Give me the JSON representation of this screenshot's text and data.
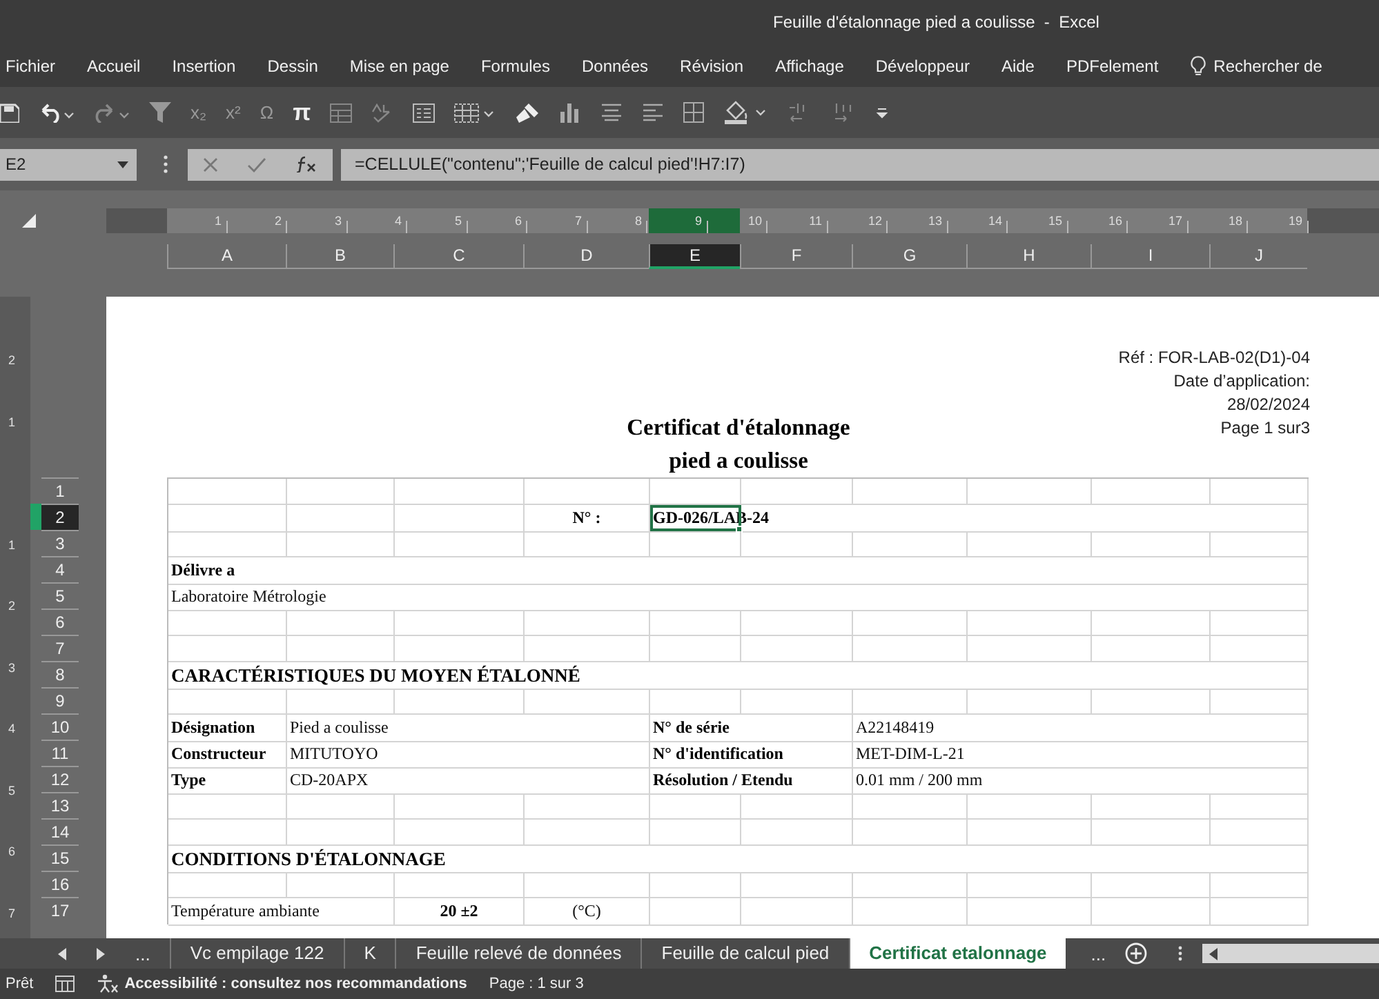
{
  "window": {
    "title": "Feuille d'étalonnage pied a coulisse  -  Excel"
  },
  "menu": [
    "Fichier",
    "Accueil",
    "Insertion",
    "Dessin",
    "Mise en page",
    "Formules",
    "Données",
    "Révision",
    "Affichage",
    "Développeur",
    "Aide",
    "PDFelement",
    "Rechercher de"
  ],
  "toolbar_glyphs": [
    "x₂",
    "x²",
    "Ω",
    "π"
  ],
  "formula_bar": {
    "name_box": "E2",
    "formula": "=CELLULE(\"contenu\";'Feuille de calcul pied'!H7:I7)"
  },
  "horizontal_ruler": [
    "1",
    "2",
    "3",
    "4",
    "5",
    "6",
    "7",
    "8",
    "9",
    "10",
    "11",
    "12",
    "13",
    "14",
    "15",
    "16",
    "17",
    "18",
    "19"
  ],
  "vertical_ruler": {
    "above": [
      "2",
      "1"
    ],
    "below": [
      "1",
      "2",
      "3",
      "4",
      "5",
      "6",
      "7"
    ]
  },
  "columns": [
    {
      "label": "A",
      "selected": false
    },
    {
      "label": "B",
      "selected": false
    },
    {
      "label": "C",
      "selected": false
    },
    {
      "label": "D",
      "selected": false
    },
    {
      "label": "E",
      "selected": true
    },
    {
      "label": "F",
      "selected": false
    },
    {
      "label": "G",
      "selected": false
    },
    {
      "label": "H",
      "selected": false
    },
    {
      "label": "I",
      "selected": false
    },
    {
      "label": "J",
      "selected": false
    }
  ],
  "page_header": {
    "reference": [
      "Réf : FOR-LAB-02(D1)-04",
      "Date d’application:",
      "28/02/2024",
      "Page  1 sur3"
    ],
    "title": [
      "Certificat d'étalonnage",
      "pied a coulisse"
    ]
  },
  "rows": [
    {
      "number": "1",
      "selected": false,
      "cells": []
    },
    {
      "number": "2",
      "selected": true,
      "cells": {
        "D": {
          "text": "N° :",
          "kind": "mark",
          "active": false
        },
        "E": {
          "text": "GD-026/LAB-24",
          "kind": "label",
          "active": true
        }
      }
    },
    {
      "number": "3",
      "selected": false,
      "cells": []
    },
    {
      "number": "4",
      "selected": false,
      "cells": {
        "A": {
          "text": "Délivre a",
          "kind": "label",
          "active": false
        }
      }
    },
    {
      "number": "5",
      "selected": false,
      "cells": {
        "A": {
          "text": "Laboratoire Métrologie",
          "kind": "value",
          "active": false
        }
      }
    },
    {
      "number": "6",
      "selected": false,
      "cells": []
    },
    {
      "number": "7",
      "selected": false,
      "cells": []
    },
    {
      "number": "8",
      "selected": false,
      "cells": {
        "A": {
          "text": "CARACTÉRISTIQUES DU MOYEN ÉTALONNÉ",
          "kind": "heading",
          "active": false
        }
      }
    },
    {
      "number": "9",
      "selected": false,
      "cells": []
    },
    {
      "number": "10",
      "selected": false,
      "cells": {
        "A": {
          "text": "Désignation",
          "kind": "label",
          "active": false
        },
        "B": {
          "text": "Pied a coulisse",
          "kind": "value",
          "active": false
        },
        "E": {
          "text": "N° de  série",
          "kind": "label",
          "active": false
        },
        "G": {
          "text": "A22148419",
          "kind": "value",
          "active": false
        }
      }
    },
    {
      "number": "11",
      "selected": false,
      "cells": {
        "A": {
          "text": "Constructeur",
          "kind": "label",
          "active": false
        },
        "B": {
          "text": "MITUTOYO",
          "kind": "value",
          "active": false
        },
        "E": {
          "text": "N° d'identification",
          "kind": "label",
          "active": false
        },
        "G": {
          "text": "MET-DIM-L-21",
          "kind": "value",
          "active": false
        }
      }
    },
    {
      "number": "12",
      "selected": false,
      "cells": {
        "A": {
          "text": "Type",
          "kind": "label",
          "active": false
        },
        "B": {
          "text": "CD-20APX",
          "kind": "value",
          "active": false
        },
        "E": {
          "text": "Résolution / Etendu",
          "kind": "label",
          "active": false
        },
        "G": {
          "text": "0.01 mm / 200 mm",
          "kind": "value",
          "active": false
        }
      }
    },
    {
      "number": "13",
      "selected": false,
      "cells": []
    },
    {
      "number": "14",
      "selected": false,
      "cells": []
    },
    {
      "number": "15",
      "selected": false,
      "cells": {
        "A": {
          "text": "CONDITIONS D'ÉTALONNAGE",
          "kind": "heading",
          "active": false
        }
      }
    },
    {
      "number": "16",
      "selected": false,
      "cells": []
    },
    {
      "number": "17",
      "selected": false,
      "cells": {
        "A": {
          "text": "Température ambiante",
          "kind": "value",
          "active": false
        },
        "C": {
          "text": "20 ±2",
          "kind": "mark",
          "active": false
        },
        "D": {
          "text": "(°C)",
          "kind": "unit",
          "active": false
        }
      }
    }
  ],
  "sheet_tabs": {
    "overflow_left": "...",
    "tabs": [
      {
        "label": "Vc empilage 122",
        "selected": false
      },
      {
        "label": "K",
        "selected": false
      },
      {
        "label": "Feuille relevé de données",
        "selected": false
      },
      {
        "label": "Feuille de calcul pied",
        "selected": false
      },
      {
        "label": "Certificat etalonnage",
        "selected": true
      }
    ],
    "overflow_right": "..."
  },
  "status_bar": {
    "mode": "Prêt",
    "accessibility": "Accessibilité : consultez nos recommandations",
    "page": "Page : 1 sur 3"
  }
}
